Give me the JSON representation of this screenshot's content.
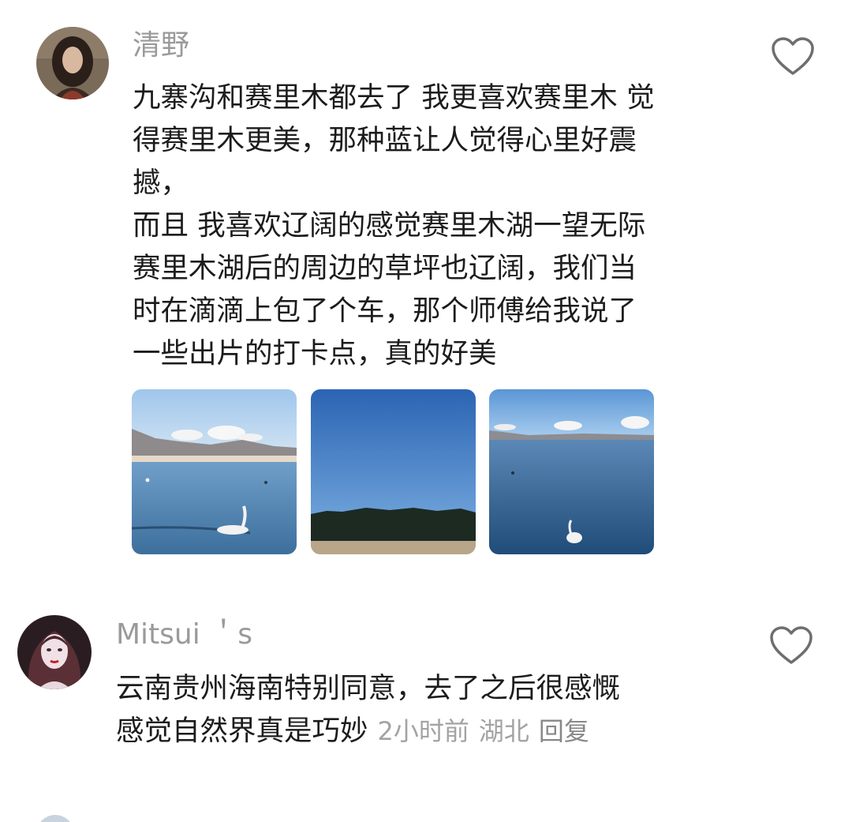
{
  "comments": [
    {
      "username": "清野",
      "avatar_icon": "user-avatar-icon",
      "text_lines": [
        "九寨沟和赛里木都去了 我更喜欢赛里木 觉",
        "得赛里木更美，那种蓝让人觉得心里好震",
        "撼，",
        "而且 我喜欢辽阔的感觉赛里木湖一望无际",
        "赛里木湖后的周边的草坪也辽阔，我们当",
        "时在滴滴上包了个车，那个师傅给我说了",
        "一些出片的打卡点，真的好美"
      ],
      "like_icon": "heart-outline-icon",
      "photos": [
        {
          "subject": "lake-with-swan-and-mountains"
        },
        {
          "subject": "blue-sky-over-forest"
        },
        {
          "subject": "lake-with-swan-and-clouds"
        }
      ]
    },
    {
      "username": "Mitsui ＇s",
      "avatar_icon": "user-avatar-icon",
      "text_lines": [
        "云南贵州海南特别同意，去了之后很感慨",
        "感觉自然界真是巧妙"
      ],
      "time": "2小时前",
      "location": "湖北",
      "reply_label": "回复",
      "like_icon": "heart-outline-icon"
    }
  ],
  "colors": {
    "username": "#9a9a9a",
    "text": "#1c1c1c",
    "meta": "#a3a3a3",
    "background": "#ffffff"
  }
}
